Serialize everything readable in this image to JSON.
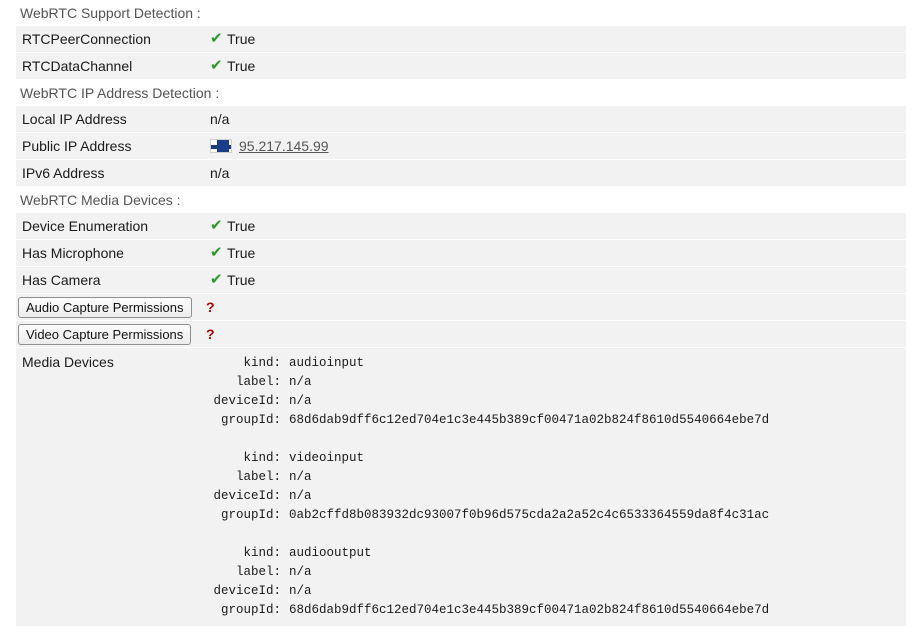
{
  "support": {
    "title": "WebRTC Support Detection :",
    "rows": [
      {
        "label": "RTCPeerConnection",
        "value": "True"
      },
      {
        "label": "RTCDataChannel",
        "value": "True"
      }
    ]
  },
  "ip": {
    "title": "WebRTC IP Address Detection :",
    "local_label": "Local IP Address",
    "local_value": "n/a",
    "public_label": "Public IP Address",
    "public_value": "95.217.145.99",
    "public_flag_icon": "finland-flag-icon",
    "ipv6_label": "IPv6 Address",
    "ipv6_value": "n/a"
  },
  "media": {
    "title": "WebRTC Media Devices :",
    "rows": [
      {
        "label": "Device Enumeration",
        "value": "True"
      },
      {
        "label": "Has Microphone",
        "value": "True"
      },
      {
        "label": "Has Camera",
        "value": "True"
      }
    ],
    "audio_button": "Audio Capture Permissions",
    "audio_status": "?",
    "video_button": "Video Capture Permissions",
    "video_status": "?",
    "devices_label": "Media Devices",
    "keys": {
      "kind": "kind:",
      "label": "label:",
      "deviceId": "deviceId:",
      "groupId": "groupId:"
    },
    "devices": [
      {
        "kind": "audioinput",
        "label": "n/a",
        "deviceId": "n/a",
        "groupId": "68d6dab9dff6c12ed704e1c3e445b389cf00471a02b824f8610d5540664ebe7d"
      },
      {
        "kind": "videoinput",
        "label": "n/a",
        "deviceId": "n/a",
        "groupId": "0ab2cffd8b083932dc93007f0b96d575cda2a2a52c4c6533364559da8f4c31ac"
      },
      {
        "kind": "audiooutput",
        "label": "n/a",
        "deviceId": "n/a",
        "groupId": "68d6dab9dff6c12ed704e1c3e445b389cf00471a02b824f8610d5540664ebe7d"
      }
    ]
  },
  "colors": {
    "check": "#2e9a2e",
    "question": "#b00000",
    "row_bg": "#f2f2f2"
  }
}
